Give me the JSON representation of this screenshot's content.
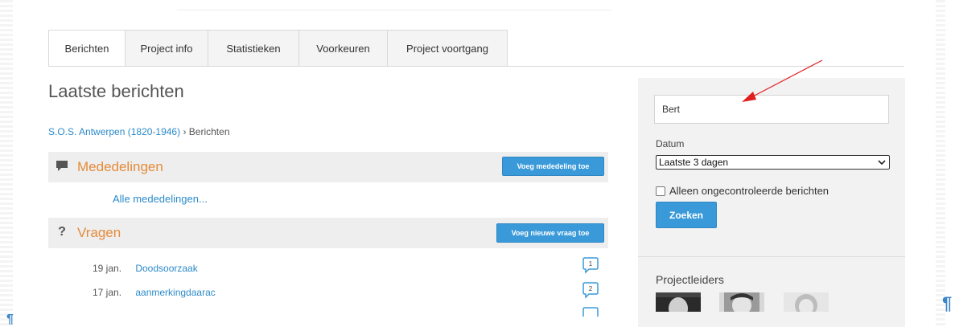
{
  "tabs": [
    {
      "label": "Berichten"
    },
    {
      "label": "Project info"
    },
    {
      "label": "Statistieken"
    },
    {
      "label": "Voorkeuren"
    },
    {
      "label": "Project voortgang"
    }
  ],
  "active_tab": "Berichten",
  "page": {
    "title": "Laatste berichten"
  },
  "breadcrumb": {
    "project": "S.O.S. Antwerpen (1820-1946)",
    "separator": "›",
    "current": "Berichten"
  },
  "announcements": {
    "title": "Mededelingen",
    "add_button": "Voeg mededeling toe",
    "all_link": "Alle mededelingen..."
  },
  "questions": {
    "title": "Vragen",
    "icon_glyph": "?",
    "add_button": "Voeg nieuwe vraag toe",
    "items": [
      {
        "date": "19 jan.",
        "title": "Doodsoorzaak",
        "count": "1"
      },
      {
        "date": "17 jan.",
        "title": "aanmerkingdaarac",
        "count": "2"
      }
    ]
  },
  "search": {
    "value": "Bert"
  },
  "filter": {
    "datum_label": "Datum",
    "datum_selected": "Laatste 3 dagen",
    "unchecked_only_label": "Alleen ongecontroleerde berichten",
    "unchecked_only": false,
    "submit_label": "Zoeken"
  },
  "project_leaders": {
    "title": "Projectleiders"
  },
  "editor": {
    "pilcrow": "¶"
  },
  "colors": {
    "accent_blue": "#3a9ad9",
    "link_blue": "#2b8ac9",
    "section_orange": "#e58b3a",
    "annotation_red": "#e02020"
  }
}
